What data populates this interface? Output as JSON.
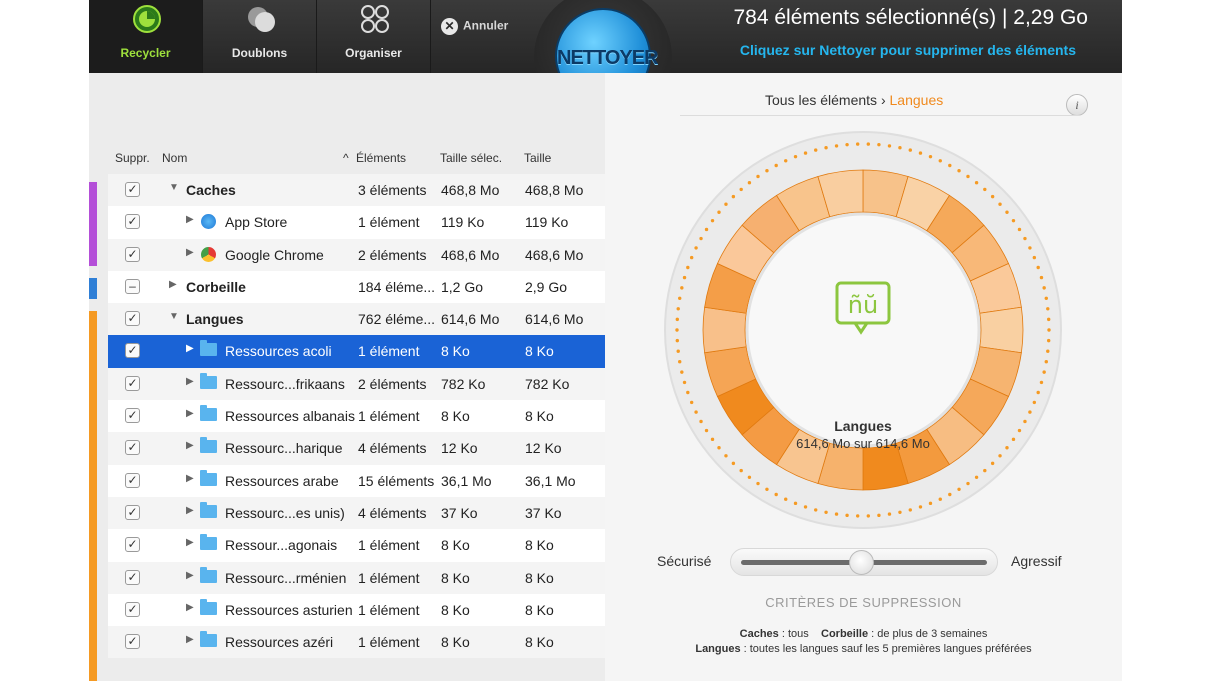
{
  "toolbar": {
    "tools": [
      {
        "label": "Recycler",
        "icon": "recycle-icon",
        "active": true
      },
      {
        "label": "Doublons",
        "icon": "duplicates-icon",
        "active": false
      },
      {
        "label": "Organiser",
        "icon": "organize-icon",
        "active": false
      }
    ],
    "cancel_label": "Annuler",
    "clean_label": "NETTOYER",
    "selection_title": "784 éléments sélectionné(s) | 2,29 Go",
    "selection_hint": "Cliquez sur Nettoyer pour supprimer des éléments"
  },
  "table": {
    "headers": {
      "delete": "Suppr.",
      "name": "Nom",
      "elements": "Éléments",
      "selected_size": "Taille sélec.",
      "size": "Taille"
    },
    "sort_indicator": "^",
    "rows": [
      {
        "name": "Caches",
        "elements": "3 éléments",
        "selected_size": "468,8 Mo",
        "size": "468,8 Mo",
        "level": 0,
        "expanded": true,
        "check": "checked"
      },
      {
        "name": "App Store",
        "elements": "1 élément",
        "selected_size": "119 Ko",
        "size": "119 Ko",
        "level": 1,
        "icon": "app-store-icon",
        "check": "checked"
      },
      {
        "name": "Google Chrome",
        "elements": "2 éléments",
        "selected_size": "468,6 Mo",
        "size": "468,6 Mo",
        "level": 1,
        "icon": "chrome-icon",
        "check": "checked"
      },
      {
        "name": "Corbeille",
        "elements": "184 éléme...",
        "selected_size": "1,2 Go",
        "size": "2,9 Go",
        "level": 0,
        "expanded": false,
        "check": "mixed"
      },
      {
        "name": "Langues",
        "elements": "762 éléme...",
        "selected_size": "614,6 Mo",
        "size": "614,6 Mo",
        "level": 0,
        "expanded": true,
        "check": "checked"
      },
      {
        "name": "Ressources acoli",
        "elements": "1 élément",
        "selected_size": "8 Ko",
        "size": "8 Ko",
        "level": 1,
        "icon": "folder-icon",
        "check": "checked",
        "selected": true
      },
      {
        "name": "Ressourc...frikaans",
        "elements": "2 éléments",
        "selected_size": "782 Ko",
        "size": "782 Ko",
        "level": 1,
        "icon": "folder-icon",
        "check": "checked"
      },
      {
        "name": "Ressources albanais",
        "elements": "1 élément",
        "selected_size": "8 Ko",
        "size": "8 Ko",
        "level": 1,
        "icon": "folder-icon",
        "check": "checked"
      },
      {
        "name": "Ressourc...harique",
        "elements": "4 éléments",
        "selected_size": "12 Ko",
        "size": "12 Ko",
        "level": 1,
        "icon": "folder-icon",
        "check": "checked"
      },
      {
        "name": "Ressources arabe",
        "elements": "15 éléments",
        "selected_size": "36,1 Mo",
        "size": "36,1 Mo",
        "level": 1,
        "icon": "folder-icon",
        "check": "checked"
      },
      {
        "name": "Ressourc...es unis)",
        "elements": "4 éléments",
        "selected_size": "37 Ko",
        "size": "37 Ko",
        "level": 1,
        "icon": "folder-icon",
        "check": "checked"
      },
      {
        "name": "Ressour...agonais",
        "elements": "1 élément",
        "selected_size": "8 Ko",
        "size": "8 Ko",
        "level": 1,
        "icon": "folder-icon",
        "check": "checked"
      },
      {
        "name": "Ressourc...rménien",
        "elements": "1 élément",
        "selected_size": "8 Ko",
        "size": "8 Ko",
        "level": 1,
        "icon": "folder-icon",
        "check": "checked"
      },
      {
        "name": "Ressources asturien",
        "elements": "1 élément",
        "selected_size": "8 Ko",
        "size": "8 Ko",
        "level": 1,
        "icon": "folder-icon",
        "check": "checked"
      },
      {
        "name": "Ressources azéri",
        "elements": "1 élément",
        "selected_size": "8 Ko",
        "size": "8 Ko",
        "level": 1,
        "icon": "folder-icon",
        "check": "checked"
      }
    ],
    "group_colors": {
      "caches": "#b44fd8",
      "corbeille": "#2f7fd6",
      "langues": "#f59a23"
    }
  },
  "detail": {
    "breadcrumb_root": "Tous les éléments",
    "breadcrumb_sep": "›",
    "breadcrumb_current": "Langues",
    "info_label": "i",
    "dial_label": "Langues",
    "dial_sub": "614,6 Mo sur 614,6 Mo",
    "dial_icon": "languages-icon",
    "accent": "#f08a1e",
    "slider_left": "Sécurisé",
    "slider_right": "Agressif",
    "criteria_title": "CRITÈRES DE SUPPRESSION",
    "criteria_caches_key": "Caches",
    "criteria_caches_val": " : tous",
    "criteria_trash_key": "Corbeille",
    "criteria_trash_val": " : de plus de 3 semaines",
    "criteria_lang_key": "Langues",
    "criteria_lang_val": " : toutes les langues sauf les 5 premières langues préférées"
  }
}
